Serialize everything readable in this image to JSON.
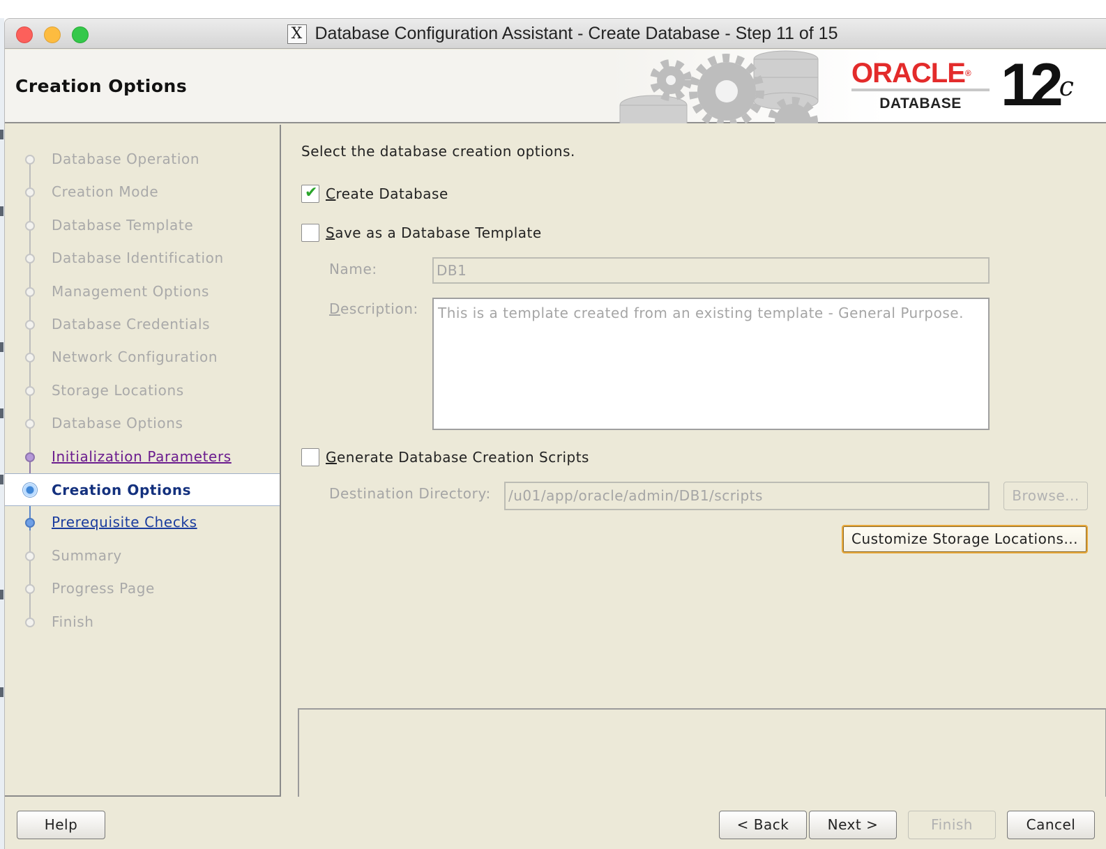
{
  "window": {
    "title": "Database Configuration Assistant - Create Database - Step 11 of 15",
    "x_icon": "X"
  },
  "banner": {
    "page_title": "Creation Options",
    "brand_word": "ORACLE",
    "brand_reg": "®",
    "brand_sub": "DATABASE",
    "version_num": "12",
    "version_suffix": "c",
    "brand_color": "#e32b2b"
  },
  "nav": {
    "items": [
      {
        "label": "Database Operation",
        "state": "done"
      },
      {
        "label": "Creation Mode",
        "state": "done"
      },
      {
        "label": "Database Template",
        "state": "done"
      },
      {
        "label": "Database Identification",
        "state": "done"
      },
      {
        "label": "Management Options",
        "state": "done"
      },
      {
        "label": "Database Credentials",
        "state": "done"
      },
      {
        "label": "Network Configuration",
        "state": "done"
      },
      {
        "label": "Storage Locations",
        "state": "done"
      },
      {
        "label": "Database Options",
        "state": "done"
      },
      {
        "label": "Initialization Parameters",
        "state": "visited-link"
      },
      {
        "label": "Creation Options",
        "state": "current"
      },
      {
        "label": "Prerequisite Checks",
        "state": "link"
      },
      {
        "label": "Summary",
        "state": "future"
      },
      {
        "label": "Progress Page",
        "state": "future"
      },
      {
        "label": "Finish",
        "state": "future"
      }
    ]
  },
  "content": {
    "intro": "Select the database creation options.",
    "create_database": {
      "label": "Create Database",
      "checked": true
    },
    "save_template": {
      "label": "Save as a Database Template",
      "checked": false
    },
    "name_label": "Name:",
    "name_value": "DB1",
    "description_label": "Description:",
    "description_value": "This is a template created from an existing template - General Purpose.",
    "generate_scripts": {
      "label": "Generate Database Creation Scripts",
      "checked": false
    },
    "destination_label": "Destination Directory:",
    "destination_value": "/u01/app/oracle/admin/DB1/scripts",
    "browse_label": "Browse...",
    "customize_label": "Customize Storage Locations..."
  },
  "footer": {
    "help": "Help",
    "back": "< Back",
    "next": "Next >",
    "finish": "Finish",
    "cancel": "Cancel"
  }
}
